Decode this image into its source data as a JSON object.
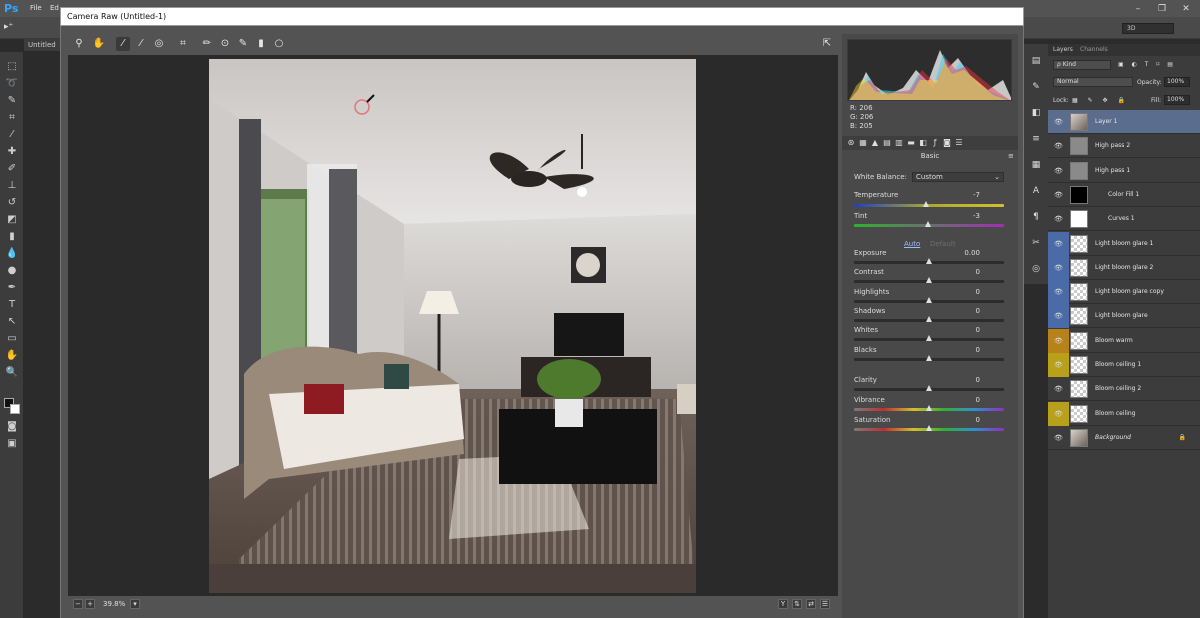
{
  "photoshop": {
    "logo": "Ps",
    "menus": [
      "File",
      "Ed"
    ],
    "document_tab": "Untitled",
    "workspace": "3D",
    "window_controls": [
      "–",
      "❐",
      "✕"
    ]
  },
  "camera_raw": {
    "title": "Camera Raw (Untitled-1)",
    "zoom": "39.8%",
    "rgb": {
      "r": "R:  206",
      "g": "G:  206",
      "b": "B:  205"
    },
    "panel_title": "Basic",
    "white_balance": {
      "label": "White Balance:",
      "value": "Custom"
    },
    "temperature": {
      "label": "Temperature",
      "value": "-7",
      "level": 0.48
    },
    "tint": {
      "label": "Tint",
      "value": "-3",
      "level": 0.49
    },
    "auto_label": "Auto",
    "default_label": "Default",
    "sliders": [
      {
        "label": "Exposure",
        "value": "0.00",
        "level": 0.5,
        "type": "gray"
      },
      {
        "label": "Contrast",
        "value": "0",
        "level": 0.5,
        "type": "gray"
      },
      {
        "label": "Highlights",
        "value": "0",
        "level": 0.5,
        "type": "gray"
      },
      {
        "label": "Shadows",
        "value": "0",
        "level": 0.5,
        "type": "gray"
      },
      {
        "label": "Whites",
        "value": "0",
        "level": 0.5,
        "type": "gray"
      },
      {
        "label": "Blacks",
        "value": "0",
        "level": 0.5,
        "type": "gray"
      },
      {
        "label": "Clarity",
        "value": "0",
        "level": 0.5,
        "type": "gray"
      },
      {
        "label": "Vibrance",
        "value": "0",
        "level": 0.5,
        "type": "sat"
      },
      {
        "label": "Saturation",
        "value": "0",
        "level": 0.5,
        "type": "sat"
      }
    ]
  },
  "layers_panel": {
    "tabs": [
      "Layers",
      "Channels"
    ],
    "kind": "ρ Kind",
    "blend_mode": "Normal",
    "opacity_label": "Opacity:",
    "opacity_value": "100%",
    "lock_label": "Lock:",
    "fill_label": "Fill:",
    "fill_value": "100%",
    "layers": [
      {
        "name": "Layer 1",
        "selected": true,
        "eye_color": "",
        "thumb": "photo"
      },
      {
        "name": "High pass 2",
        "selected": false,
        "eye_color": "",
        "thumb": "gray"
      },
      {
        "name": "High pass 1",
        "selected": false,
        "eye_color": "",
        "thumb": "gray"
      },
      {
        "name": "Color Fill 1",
        "selected": false,
        "eye_color": "",
        "thumb": "black"
      },
      {
        "name": "Curves 1",
        "selected": false,
        "eye_color": "",
        "thumb": "white"
      },
      {
        "name": "Light bloom glare 1",
        "selected": false,
        "eye_color": "#4a6aa8",
        "thumb": "checker"
      },
      {
        "name": "Light bloom glare 2",
        "selected": false,
        "eye_color": "#4a6aa8",
        "thumb": "checker"
      },
      {
        "name": "Light bloom glare copy",
        "selected": false,
        "eye_color": "#4a6aa8",
        "thumb": "checker"
      },
      {
        "name": "Light bloom glare",
        "selected": false,
        "eye_color": "#4a6aa8",
        "thumb": "checker"
      },
      {
        "name": "Bloom warm",
        "selected": false,
        "eye_color": "#b8821a",
        "thumb": "checker"
      },
      {
        "name": "Bloom ceiling 1",
        "selected": false,
        "eye_color": "#b8a01a",
        "thumb": "checker"
      },
      {
        "name": "Bloom ceiling 2",
        "selected": false,
        "eye_color": "",
        "thumb": "checker"
      },
      {
        "name": "Bloom ceiling",
        "selected": false,
        "eye_color": "#b8a01a",
        "thumb": "checker"
      },
      {
        "name": "Background",
        "selected": false,
        "eye_color": "",
        "thumb": "photo"
      }
    ]
  }
}
